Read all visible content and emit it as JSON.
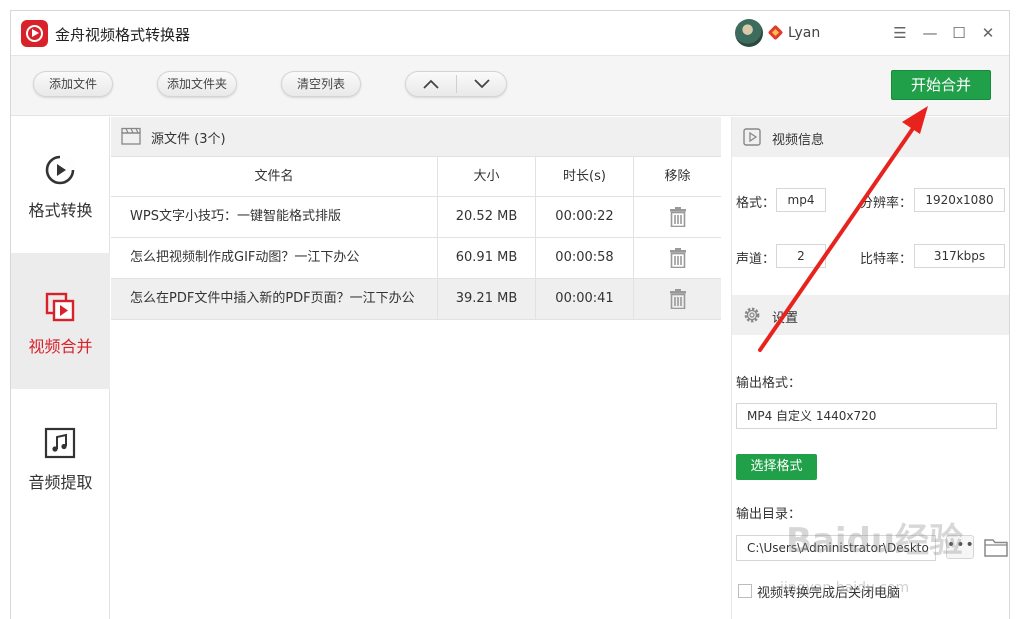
{
  "app": {
    "title": "金舟视频格式转换器",
    "username": "Lyan"
  },
  "window_controls": {
    "menu": "☰",
    "minimize": "—",
    "maximize": "☐",
    "close": "✕"
  },
  "toolbar": {
    "add_file": "添加文件",
    "add_folder": "添加文件夹",
    "clear_list": "清空列表",
    "start_merge": "开始合并"
  },
  "sidebar": {
    "items": [
      {
        "label": "格式转换",
        "icon": "play-circle-icon",
        "active": false
      },
      {
        "label": "视频合并",
        "icon": "video-merge-icon",
        "active": true
      },
      {
        "label": "音频提取",
        "icon": "music-note-icon",
        "active": false
      }
    ]
  },
  "file_list": {
    "title": "源文件 (3个)",
    "columns": [
      "文件名",
      "大小",
      "时长(s)",
      "移除"
    ],
    "rows": [
      {
        "name": "WPS文字小技巧：一键智能格式排版",
        "size": "20.52 MB",
        "duration": "00:00:22"
      },
      {
        "name": "怎么把视频制作成GIF动图？一江下办公",
        "size": "60.91 MB",
        "duration": "00:00:58"
      },
      {
        "name": "怎么在PDF文件中插入新的PDF页面？一江下办公",
        "size": "39.21 MB",
        "duration": "00:00:41"
      }
    ]
  },
  "video_info": {
    "title": "视频信息",
    "format_label": "格式：",
    "format_value": "mp4",
    "resolution_label": "分辨率：",
    "resolution_value": "1920x1080",
    "channel_label": "声道：",
    "channel_value": "2",
    "bitrate_label": "比特率：",
    "bitrate_value": "317kbps"
  },
  "settings": {
    "title": "设置",
    "output_format_label": "输出格式：",
    "output_format_value": "MP4 自定义 1440x720",
    "choose_format": "选择格式",
    "output_dir_label": "输出目录：",
    "output_dir_value": "C:\\Users\\Administrator\\Deskto",
    "browse": "•••",
    "shutdown_label": "视频转换完成后关闭电脑"
  },
  "watermark": {
    "text": "Baidu经验",
    "sub": "jingyan.baidu.com"
  },
  "colors": {
    "accent_red": "#d8222a",
    "green": "#21a04a"
  }
}
